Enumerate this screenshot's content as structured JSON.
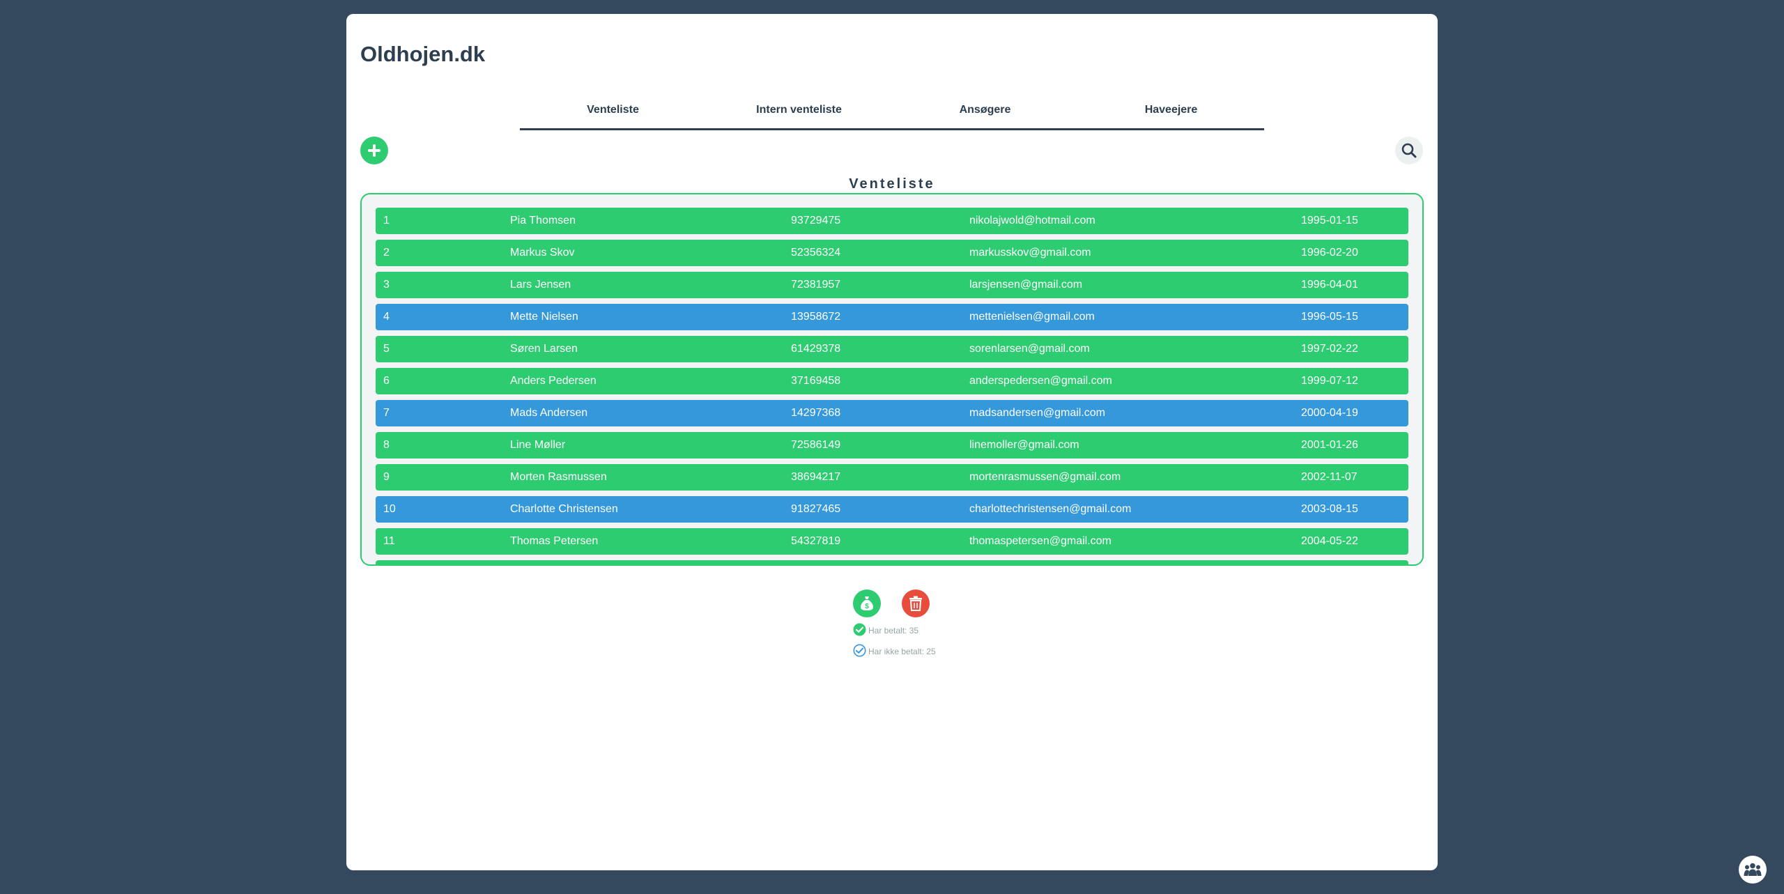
{
  "site": {
    "title": "Oldhojen.dk"
  },
  "tabs": [
    {
      "label": "Venteliste"
    },
    {
      "label": "Intern venteliste"
    },
    {
      "label": "Ansøgere"
    },
    {
      "label": "Haveejere"
    }
  ],
  "list": {
    "title": "Venteliste",
    "rows": [
      {
        "num": "1",
        "name": "Pia Thomsen",
        "phone": "93729475",
        "email": "nikolajwold@hotmail.com",
        "date": "1995-01-15",
        "status": "green"
      },
      {
        "num": "2",
        "name": "Markus Skov",
        "phone": "52356324",
        "email": "markusskov@gmail.com",
        "date": "1996-02-20",
        "status": "green"
      },
      {
        "num": "3",
        "name": "Lars Jensen",
        "phone": "72381957",
        "email": "larsjensen@gmail.com",
        "date": "1996-04-01",
        "status": "green"
      },
      {
        "num": "4",
        "name": "Mette Nielsen",
        "phone": "13958672",
        "email": "mettenielsen@gmail.com",
        "date": "1996-05-15",
        "status": "blue"
      },
      {
        "num": "5",
        "name": "Søren Larsen",
        "phone": "61429378",
        "email": "sorenlarsen@gmail.com",
        "date": "1997-02-22",
        "status": "green"
      },
      {
        "num": "6",
        "name": "Anders Pedersen",
        "phone": "37169458",
        "email": "anderspedersen@gmail.com",
        "date": "1999-07-12",
        "status": "green"
      },
      {
        "num": "7",
        "name": "Mads Andersen",
        "phone": "14297368",
        "email": "madsandersen@gmail.com",
        "date": "2000-04-19",
        "status": "blue"
      },
      {
        "num": "8",
        "name": "Line Møller",
        "phone": "72586149",
        "email": "linemoller@gmail.com",
        "date": "2001-01-26",
        "status": "green"
      },
      {
        "num": "9",
        "name": "Morten Rasmussen",
        "phone": "38694217",
        "email": "mortenrasmussen@gmail.com",
        "date": "2002-11-07",
        "status": "green"
      },
      {
        "num": "10",
        "name": "Charlotte Christensen",
        "phone": "91827465",
        "email": "charlottechristensen@gmail.com",
        "date": "2003-08-15",
        "status": "blue"
      },
      {
        "num": "11",
        "name": "Thomas Petersen",
        "phone": "54327819",
        "email": "thomaspetersen@gmail.com",
        "date": "2004-05-22",
        "status": "green"
      },
      {
        "num": "",
        "name": "",
        "phone": "",
        "email": "",
        "date": "",
        "status": "green"
      }
    ]
  },
  "stats": {
    "paid": "Har betalt: 35",
    "unpaid": "Har ikke betalt: 25"
  },
  "colors": {
    "background": "#34495e",
    "green": "#2ecc71",
    "blue": "#3498db",
    "red": "#e74c3c",
    "dark": "#2c3e50"
  },
  "icons": {
    "add": "plus-icon",
    "search": "search-icon",
    "money": "money-bag-icon",
    "trash": "trash-icon",
    "paid": "check-circle-filled-icon",
    "unpaid": "check-circle-outline-icon",
    "help": "people-group-icon"
  }
}
